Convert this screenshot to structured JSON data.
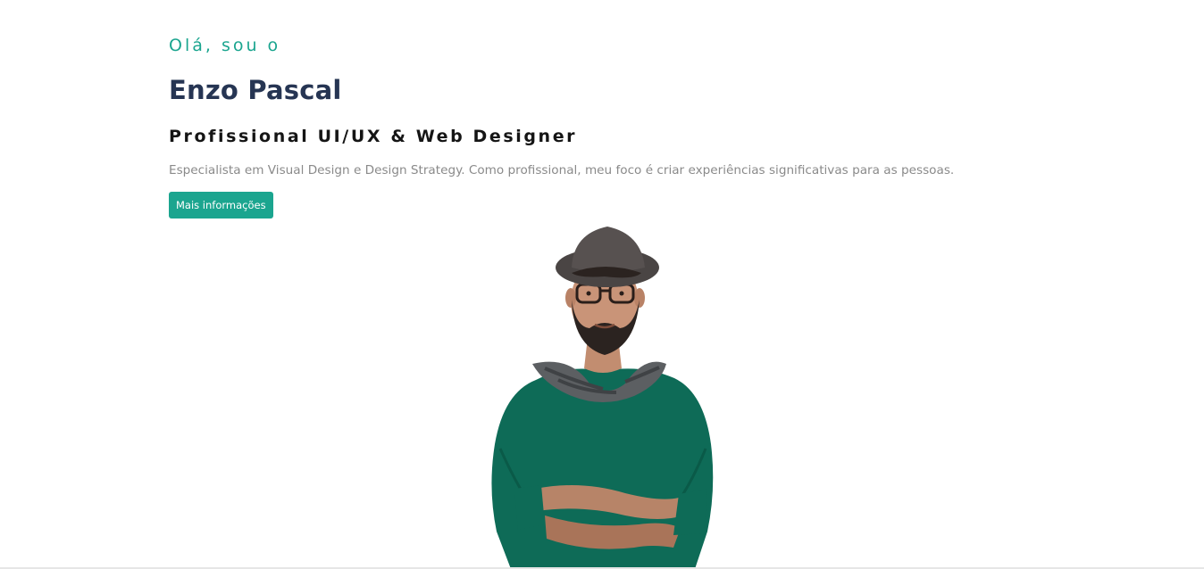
{
  "hero": {
    "greeting": "Olá, sou o",
    "name": "Enzo Pascal",
    "role": "Profissional UI/UX & Web Designer",
    "description": "Especialista em Visual Design e Design Strategy. Como profissional, meu foco é criar experiências significativas para as pessoas.",
    "cta_label": "Mais informações"
  },
  "colors": {
    "accent": "#1ba58f",
    "name": "#263553",
    "description": "#8a8a8a",
    "sweater": "#0e6b57",
    "hat": "#4a4544",
    "scarf": "#5c5f62"
  },
  "portrait": {
    "icon": "person-portrait-icon"
  }
}
